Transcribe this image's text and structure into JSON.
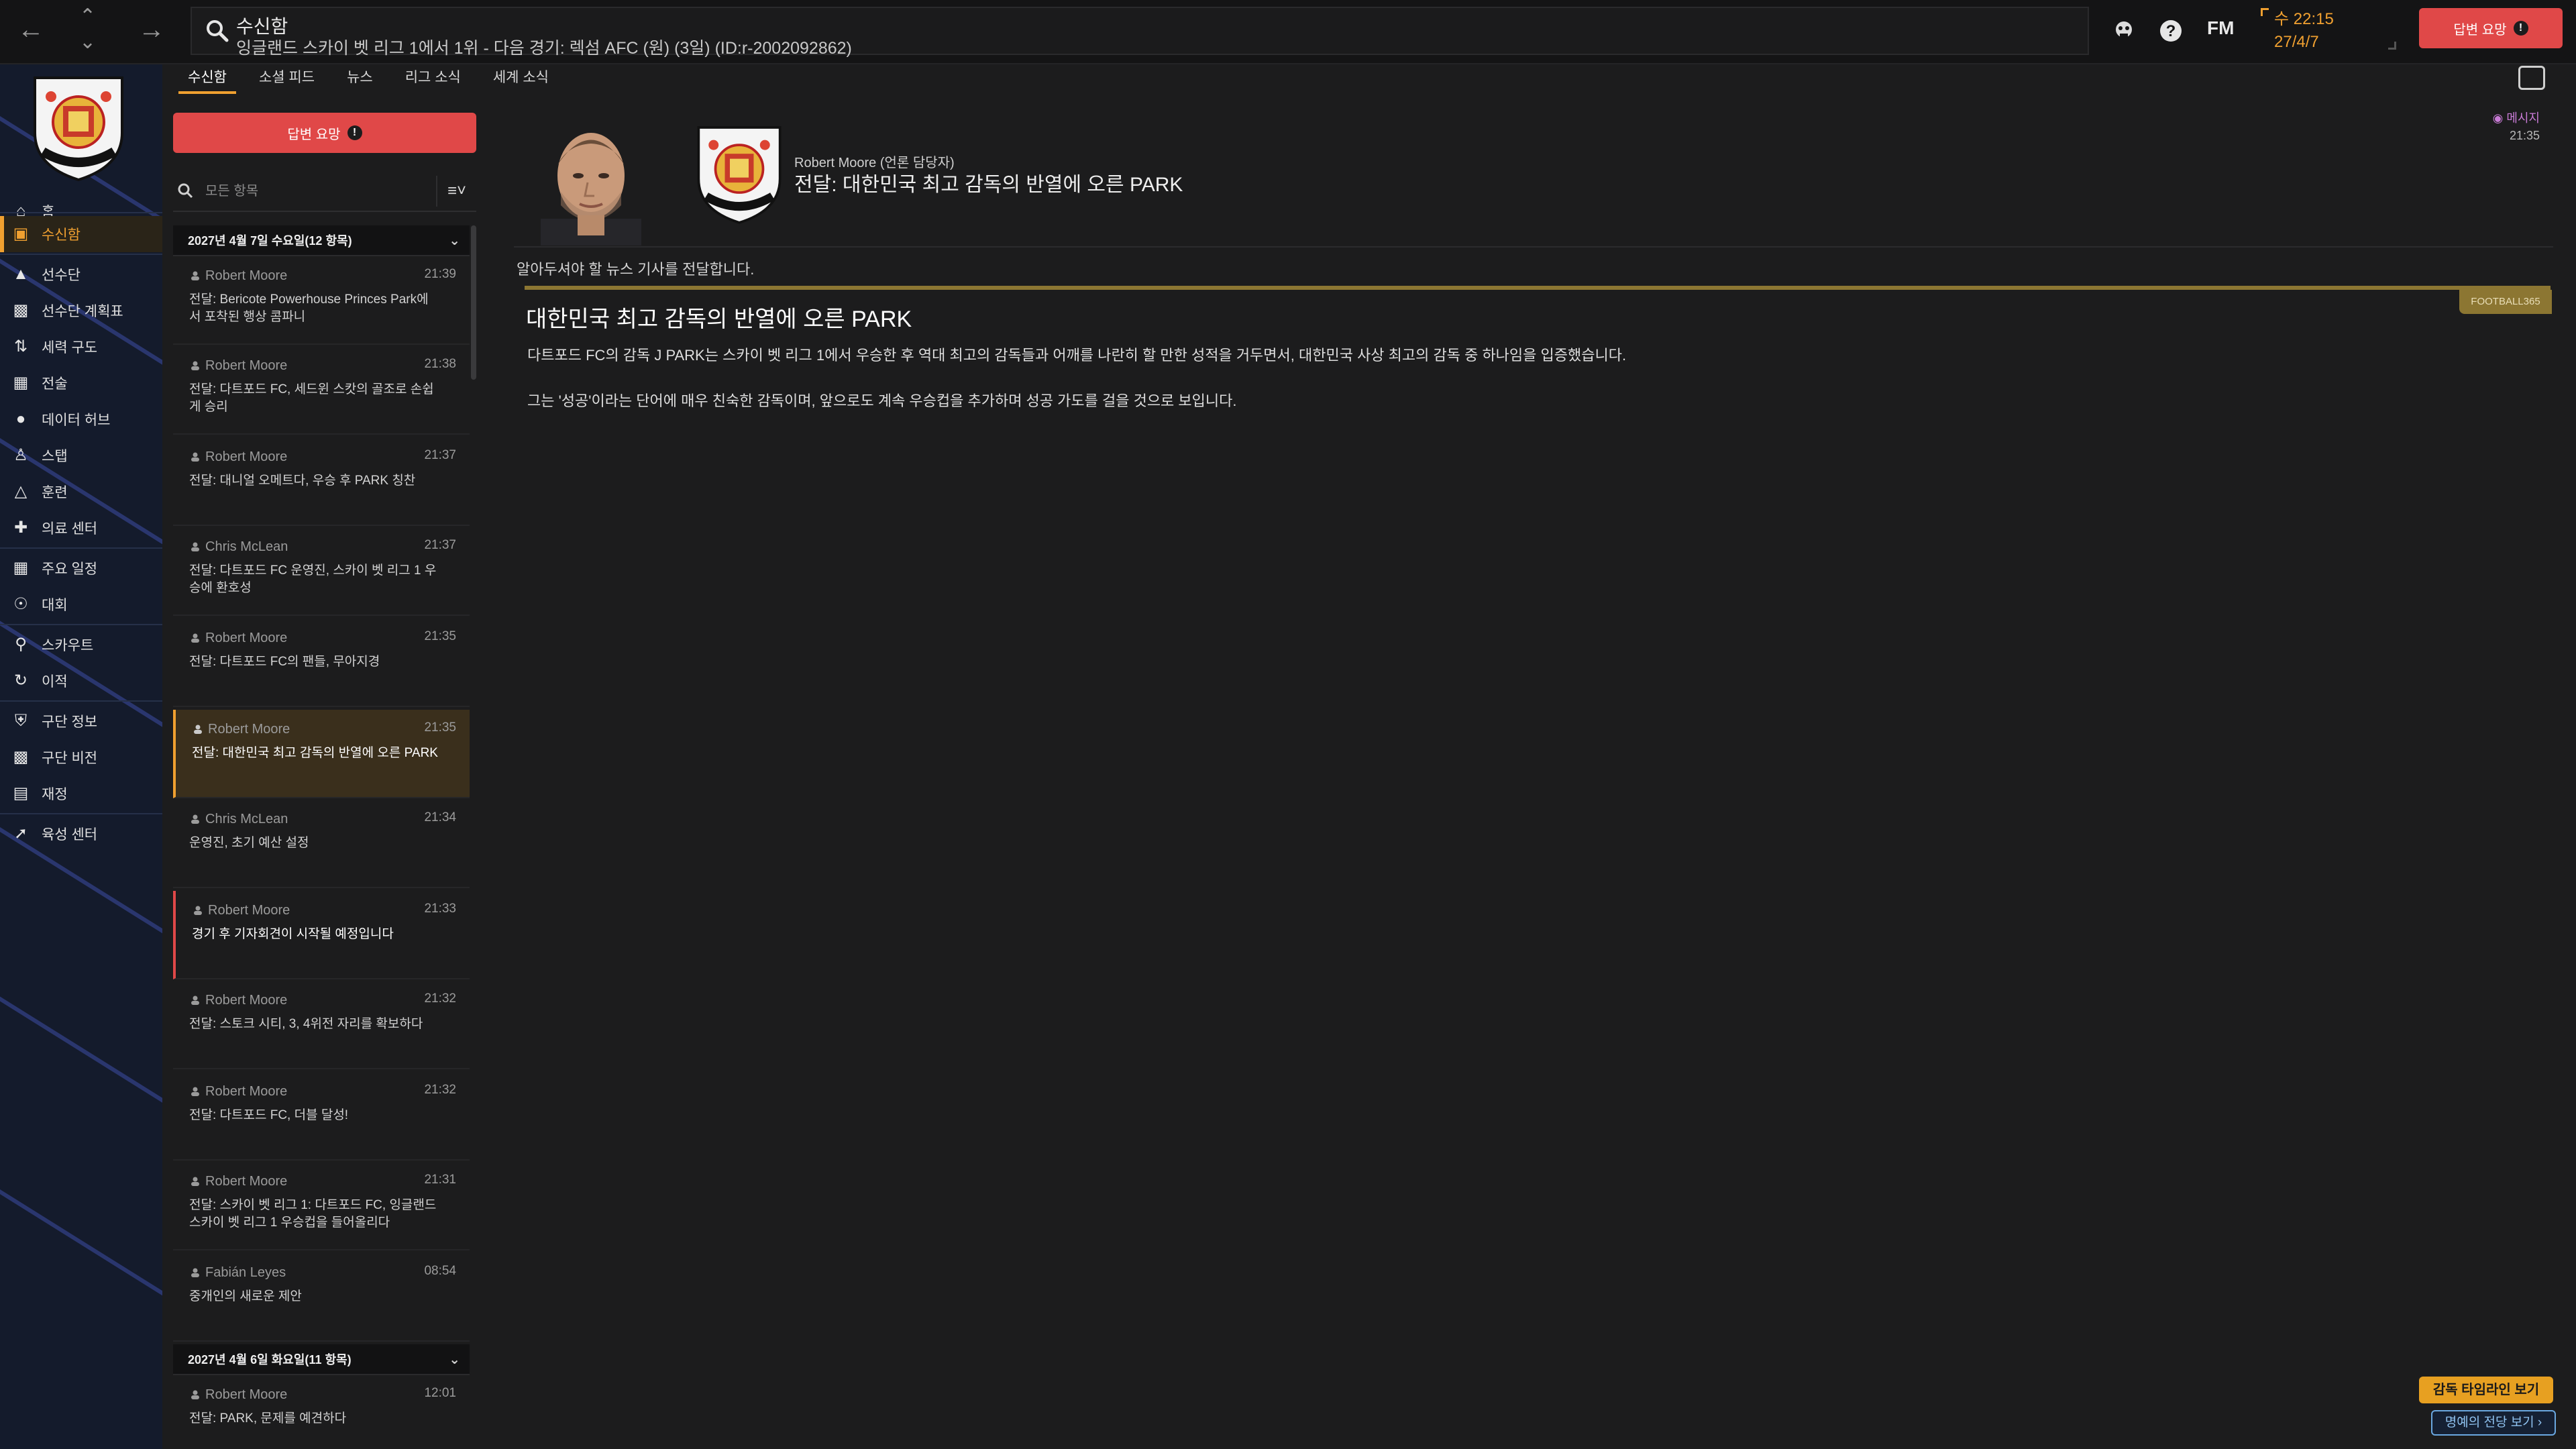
{
  "topbar": {
    "title": "수신함",
    "subtitle": "잉글랜드 스카이 벳 리그 1에서 1위 - 다음 경기: 렉섬 AFC (원) (3일) (ID:r-2002092862)",
    "fm_label": "FM",
    "clock_day_time": "수 22:15",
    "clock_date": "27/4/7",
    "reply_label": "답변 요망"
  },
  "sidebar": {
    "items": [
      {
        "label": "홈",
        "icon": "home-icon"
      },
      {
        "label": "수신함",
        "icon": "inbox-icon"
      },
      {
        "label": "선수단",
        "icon": "shirt-icon"
      },
      {
        "label": "선수단 계획표",
        "icon": "clipboard-icon"
      },
      {
        "label": "세력 구도",
        "icon": "dynamics-icon"
      },
      {
        "label": "전술",
        "icon": "tactics-icon"
      },
      {
        "label": "데이터 허브",
        "icon": "data-hub-icon"
      },
      {
        "label": "스탭",
        "icon": "staff-icon"
      },
      {
        "label": "훈련",
        "icon": "training-icon"
      },
      {
        "label": "의료 센터",
        "icon": "medical-icon"
      },
      {
        "label": "주요 일정",
        "icon": "calendar-icon"
      },
      {
        "label": "대회",
        "icon": "trophy-icon"
      },
      {
        "label": "스카우트",
        "icon": "scout-icon"
      },
      {
        "label": "이적",
        "icon": "transfer-icon"
      },
      {
        "label": "구단 정보",
        "icon": "shield-icon"
      },
      {
        "label": "구단 비전",
        "icon": "vision-icon"
      },
      {
        "label": "재정",
        "icon": "finance-icon"
      },
      {
        "label": "육성 센터",
        "icon": "development-icon"
      }
    ]
  },
  "tabs": [
    "수신함",
    "소셜 피드",
    "뉴스",
    "리그 소식",
    "세계 소식"
  ],
  "inbox": {
    "reply_button": "답변 요망",
    "filter_placeholder": "모든 항목",
    "groups": [
      {
        "header": "2027년 4월 7일 수요일(12 항목)"
      },
      {
        "header": "2027년 4월 6일 화요일(11 항목)"
      }
    ],
    "messages": [
      {
        "sender": "Robert Moore",
        "time": "21:39",
        "subject": "전달: Bericote Powerhouse Princes Park에서 포착된 행상 콤파니"
      },
      {
        "sender": "Robert Moore",
        "time": "21:38",
        "subject": "전달: 다트포드 FC, 세드윈 스캇의 골조로 손쉽게 승리"
      },
      {
        "sender": "Robert Moore",
        "time": "21:37",
        "subject": "전달: 대니얼 오메트다, 우승 후 PARK 칭찬"
      },
      {
        "sender": "Chris McLean",
        "time": "21:37",
        "subject": "전달: 다트포드 FC 운영진, 스카이 벳 리그 1 우승에 환호성"
      },
      {
        "sender": "Robert Moore",
        "time": "21:35",
        "subject": "전달: 다트포드 FC의 팬들, 무아지경"
      },
      {
        "sender": "Robert Moore",
        "time": "21:35",
        "subject": "전달: 대한민국 최고 감독의 반열에 오른 PARK"
      },
      {
        "sender": "Chris McLean",
        "time": "21:34",
        "subject": "운영진, 초기 예산 설정"
      },
      {
        "sender": "Robert Moore",
        "time": "21:33",
        "subject": "경기 후 기자회견이 시작될 예정입니다"
      },
      {
        "sender": "Robert Moore",
        "time": "21:32",
        "subject": "전달: 스토크 시티, 3, 4위전 자리를 확보하다"
      },
      {
        "sender": "Robert Moore",
        "time": "21:32",
        "subject": "전달: 다트포드 FC, 더블 달성!"
      },
      {
        "sender": "Robert Moore",
        "time": "21:31",
        "subject": "전달: 스카이 벳 리그 1: 다트포드 FC, 잉글랜드 스카이 벳 리그 1 우승컵을 들어올리다"
      },
      {
        "sender": "Fabián Leyes",
        "time": "08:54",
        "subject": "중개인의 새로운 제안"
      },
      {
        "sender": "Robert Moore",
        "time": "12:01",
        "subject": "전달: PARK, 문제를 예견하다"
      }
    ]
  },
  "message": {
    "from": "Robert Moore (언론 담당자)",
    "headline": "전달: 대한민국 최고 감독의 반열에 오른 PARK",
    "tag": "메시지",
    "time": "21:35",
    "intro": "알아두셔야 할 뉴스 기사를 전달합니다.",
    "source": "FOOTBALL365",
    "article_title": "대한민국 최고 감독의 반열에 오른 PARK",
    "paragraph1": "다트포드 FC의 감독 J PARK는 스카이 벳 리그 1에서 우승한 후 역대 최고의 감독들과 어깨를 나란히 할 만한 성적을 거두면서, 대한민국 사상 최고의 감독 중 하나임을 입증했습니다.",
    "paragraph2": "그는 '성공'이라는 단어에 매우 친숙한 감독이며, 앞으로도 계속 우승컵을 추가하며 성공 가도를 걸을 것으로 보입니다."
  },
  "footer": {
    "timeline_button": "감독 타임라인 보기",
    "hall_button": "명예의 전당 보기 ›"
  },
  "colors": {
    "accent": "#f0a030",
    "alert": "#e04848",
    "sidebar_bg": "#141b2c",
    "gold_bar": "#8c7632"
  }
}
